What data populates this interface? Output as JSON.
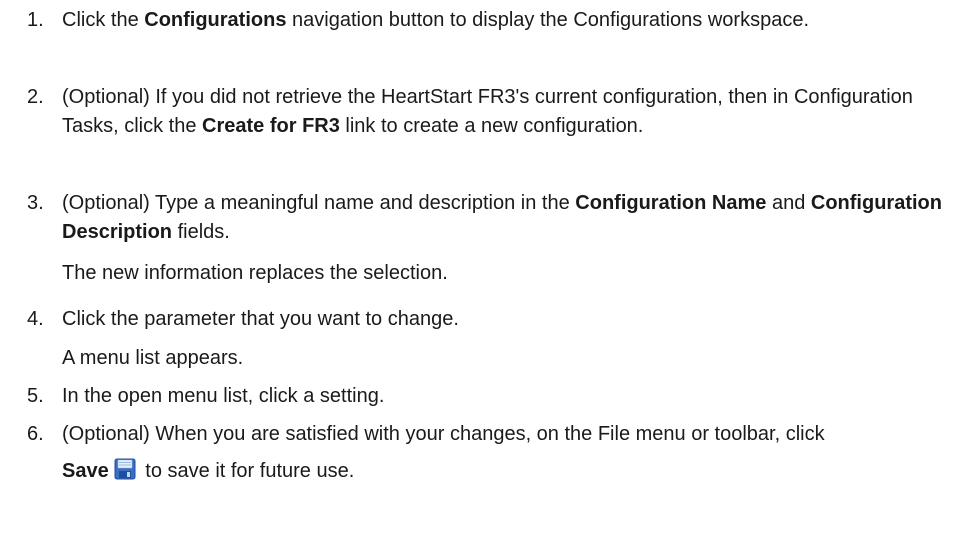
{
  "steps": [
    {
      "number": "1.",
      "t1": "Click the ",
      "b1": "Configurations",
      "t2": " navigation button to display the Configurations workspace."
    },
    {
      "number": "2.",
      "t1": "(Optional) If you did not retrieve the HeartStart FR3's current configuration, then in Configuration Tasks, click the ",
      "b1": "Create for FR3",
      "t2": " link to create a new configuration."
    },
    {
      "number": "3.",
      "t1": "(Optional) Type a meaningful name and description in the ",
      "b1": "Configuration Name",
      "t2": " and ",
      "b2": "Configuration Description",
      "t3": " fields.",
      "note": "The new information replaces the selection."
    },
    {
      "number": "4.",
      "t1": "Click the parameter that you want to change.",
      "note": "A menu list appears."
    },
    {
      "number": "5.",
      "t1": "In the open menu list, click a setting."
    },
    {
      "number": "6.",
      "t1": "(Optional) When you are satisfied with your changes, on the File menu or toolbar, click ",
      "b1": "Save",
      "icon": "floppy-disk-save-icon",
      "t2": " to save it for future use."
    }
  ],
  "colors": {
    "text": "#1a1a1a",
    "icon_blue": "#3a6fc4",
    "icon_dark_blue": "#1f4e9c"
  }
}
